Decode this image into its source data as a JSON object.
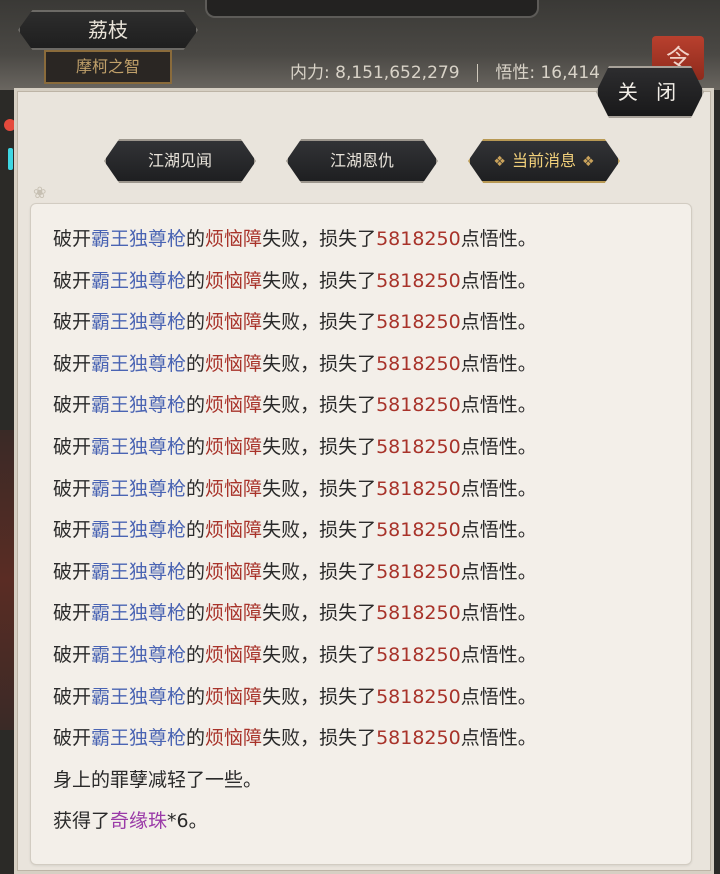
{
  "hud": {
    "character_name": "荔枝",
    "character_title": "摩柯之智",
    "server_text": "",
    "stats": {
      "neili_label": "内力:",
      "neili_value": "8,151,652,279",
      "wuxing_label": "悟性:",
      "wuxing_value": "16,414"
    },
    "side_tab_label": "令"
  },
  "panel": {
    "close_label": "关 闭",
    "tabs": [
      {
        "label": "江湖见闻",
        "active": false
      },
      {
        "label": "江湖恩仇",
        "active": false
      },
      {
        "label": "当前消息",
        "active": true
      }
    ],
    "messages": [
      {
        "prefix": "破开",
        "skill": "霸王独尊枪",
        "mid": "的",
        "item": "烦恼障",
        "suffix1": "失败，损失了",
        "amount": "5818250",
        "suffix2": "点悟性。"
      },
      {
        "prefix": "破开",
        "skill": "霸王独尊枪",
        "mid": "的",
        "item": "烦恼障",
        "suffix1": "失败，损失了",
        "amount": "5818250",
        "suffix2": "点悟性。"
      },
      {
        "prefix": "破开",
        "skill": "霸王独尊枪",
        "mid": "的",
        "item": "烦恼障",
        "suffix1": "失败，损失了",
        "amount": "5818250",
        "suffix2": "点悟性。"
      },
      {
        "prefix": "破开",
        "skill": "霸王独尊枪",
        "mid": "的",
        "item": "烦恼障",
        "suffix1": "失败，损失了",
        "amount": "5818250",
        "suffix2": "点悟性。"
      },
      {
        "prefix": "破开",
        "skill": "霸王独尊枪",
        "mid": "的",
        "item": "烦恼障",
        "suffix1": "失败，损失了",
        "amount": "5818250",
        "suffix2": "点悟性。"
      },
      {
        "prefix": "破开",
        "skill": "霸王独尊枪",
        "mid": "的",
        "item": "烦恼障",
        "suffix1": "失败，损失了",
        "amount": "5818250",
        "suffix2": "点悟性。"
      },
      {
        "prefix": "破开",
        "skill": "霸王独尊枪",
        "mid": "的",
        "item": "烦恼障",
        "suffix1": "失败，损失了",
        "amount": "5818250",
        "suffix2": "点悟性。"
      },
      {
        "prefix": "破开",
        "skill": "霸王独尊枪",
        "mid": "的",
        "item": "烦恼障",
        "suffix1": "失败，损失了",
        "amount": "5818250",
        "suffix2": "点悟性。"
      },
      {
        "prefix": "破开",
        "skill": "霸王独尊枪",
        "mid": "的",
        "item": "烦恼障",
        "suffix1": "失败，损失了",
        "amount": "5818250",
        "suffix2": "点悟性。"
      },
      {
        "prefix": "破开",
        "skill": "霸王独尊枪",
        "mid": "的",
        "item": "烦恼障",
        "suffix1": "失败，损失了",
        "amount": "5818250",
        "suffix2": "点悟性。"
      },
      {
        "prefix": "破开",
        "skill": "霸王独尊枪",
        "mid": "的",
        "item": "烦恼障",
        "suffix1": "失败，损失了",
        "amount": "5818250",
        "suffix2": "点悟性。"
      },
      {
        "prefix": "破开",
        "skill": "霸王独尊枪",
        "mid": "的",
        "item": "烦恼障",
        "suffix1": "失败，损失了",
        "amount": "5818250",
        "suffix2": "点悟性。"
      },
      {
        "prefix": "破开",
        "skill": "霸王独尊枪",
        "mid": "的",
        "item": "烦恼障",
        "suffix1": "失败，损失了",
        "amount": "5818250",
        "suffix2": "点悟性。"
      }
    ],
    "karma_message": "身上的罪孽减轻了一些。",
    "reward_message": {
      "prefix": "获得了",
      "item": "奇缘珠",
      "suffix": "*6。"
    }
  },
  "colors": {
    "skill_blue": "#4a64b3",
    "amount_red": "#a8332a",
    "item_purple": "#9a3aa8",
    "active_tab_gold": "#f0cf7a"
  }
}
